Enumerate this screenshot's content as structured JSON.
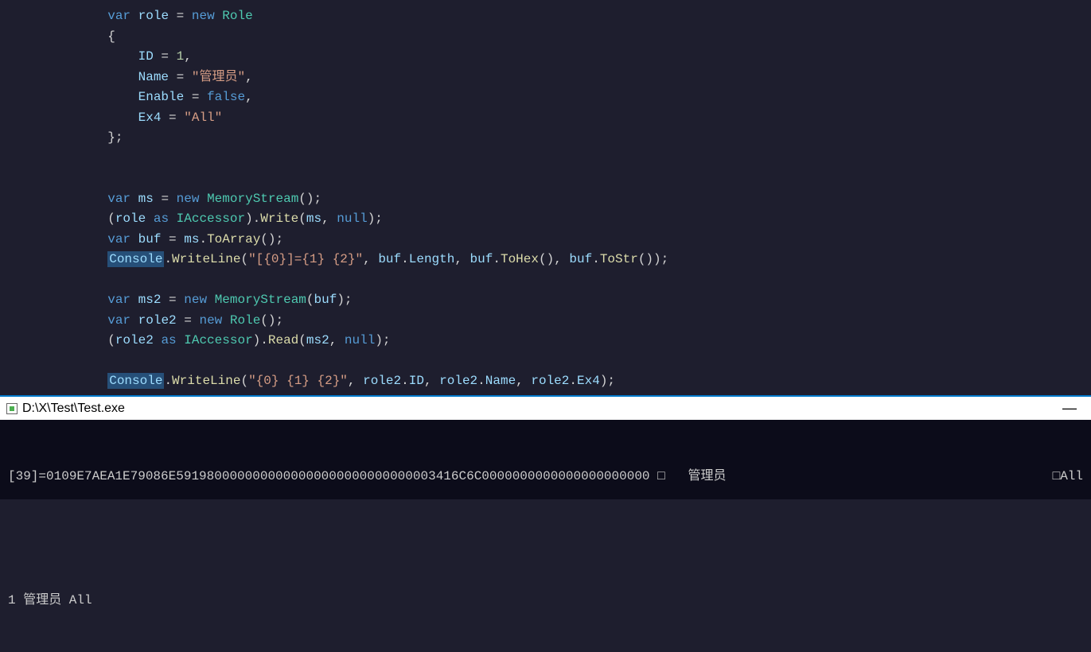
{
  "code": {
    "l1": {
      "pre": "            ",
      "kw_var": "var",
      "sp": " ",
      "name": "role",
      "eq": " = ",
      "kw_new": "new",
      "sp2": " ",
      "type": "Role"
    },
    "l2": {
      "pre": "            ",
      "brace": "{"
    },
    "l3": {
      "pre": "                ",
      "prop": "ID",
      "eq": " = ",
      "val": "1",
      "comma": ","
    },
    "l4": {
      "pre": "                ",
      "prop": "Name",
      "eq": " = ",
      "val": "\"管理员\"",
      "comma": ","
    },
    "l5": {
      "pre": "                ",
      "prop": "Enable",
      "eq": " = ",
      "val": "false",
      "comma": ","
    },
    "l6": {
      "pre": "                ",
      "prop": "Ex4",
      "eq": " = ",
      "val": "\"All\""
    },
    "l7": {
      "pre": "            ",
      "brace": "};"
    },
    "l9": {
      "pre": "            ",
      "kw_var": "var",
      "sp": " ",
      "name": "ms",
      "eq": " = ",
      "kw_new": "new",
      "sp2": " ",
      "type": "MemoryStream",
      "paren": "();"
    },
    "l10": {
      "pre": "            ",
      "open": "(",
      "name": "role",
      "kw_as": " as ",
      "type": "IAccessor",
      "close": ").",
      "method": "Write",
      "args_open": "(",
      "arg1": "ms",
      "comma": ", ",
      "arg2": "null",
      "args_close": ");"
    },
    "l11": {
      "pre": "            ",
      "kw_var": "var",
      "sp": " ",
      "name": "buf",
      "eq": " = ",
      "obj": "ms",
      "dot": ".",
      "method": "ToArray",
      "paren": "();"
    },
    "l12": {
      "pre": "            ",
      "cls": "Console",
      "dot": ".",
      "method": "WriteLine",
      "open": "(",
      "str": "\"[{0}]={1} {2}\"",
      "c1": ", ",
      "a1": "buf",
      "d1": ".",
      "p1": "Length",
      "c2": ", ",
      "a2": "buf",
      "d2": ".",
      "m2": "ToHex",
      "pp2": "()",
      "c3": ", ",
      "a3": "buf",
      "d3": ".",
      "m3": "ToStr",
      "pp3": "()",
      "close": ");"
    },
    "l14": {
      "pre": "            ",
      "kw_var": "var",
      "sp": " ",
      "name": "ms2",
      "eq": " = ",
      "kw_new": "new",
      "sp2": " ",
      "type": "MemoryStream",
      "open": "(",
      "arg": "buf",
      "close": ");"
    },
    "l15": {
      "pre": "            ",
      "kw_var": "var",
      "sp": " ",
      "name": "role2",
      "eq": " = ",
      "kw_new": "new",
      "sp2": " ",
      "type": "Role",
      "paren": "();"
    },
    "l16": {
      "pre": "            ",
      "open": "(",
      "name": "role2",
      "kw_as": " as ",
      "type": "IAccessor",
      "close": ").",
      "method": "Read",
      "args_open": "(",
      "arg1": "ms2",
      "comma": ", ",
      "arg2": "null",
      "args_close": ");"
    },
    "l18": {
      "pre": "            ",
      "cls": "Console",
      "dot": ".",
      "method": "WriteLine",
      "open": "(",
      "str": "\"{0} {1} {2}\"",
      "c1": ", ",
      "a1": "role2",
      "d1": ".",
      "p1": "ID",
      "c2": ", ",
      "a2": "role2",
      "d2": ".",
      "p2": "Name",
      "c3": ", ",
      "a3": "role2",
      "d3": ".",
      "p3": "Ex4",
      "close": ");"
    }
  },
  "terminal": {
    "title": "D:\\X\\Test\\Test.exe",
    "line1_left": "[39]=0109E7AEA1E79086E5919800000000000000000000000000003416C6C0000000000000000000000 ",
    "line1_box": "□",
    "line1_mid": "   管理员",
    "line1_right": "□All",
    "line2": "1 管理员 All"
  }
}
